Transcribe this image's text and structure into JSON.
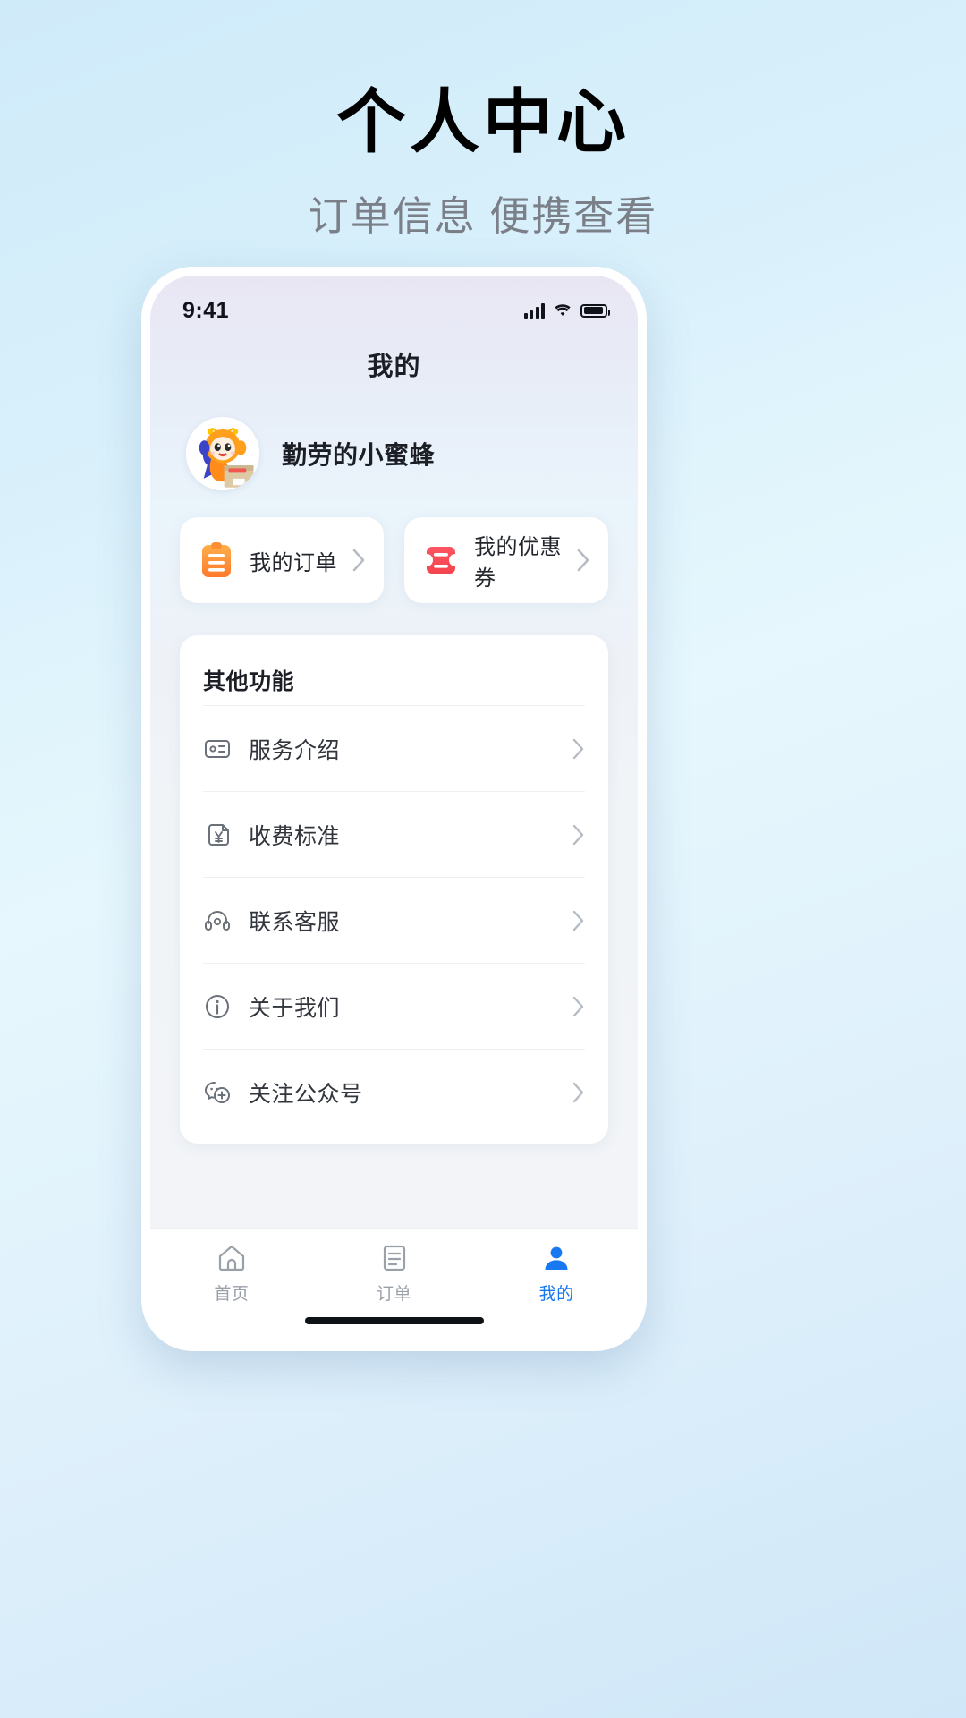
{
  "promo": {
    "title": "个人中心",
    "subtitle": "订单信息 便携查看"
  },
  "phone": {
    "statusbar": {
      "time": "9:41",
      "signal_icon": "cellular-signal-icon",
      "wifi_icon": "wifi-icon",
      "battery_icon": "battery-icon"
    },
    "navbar": {
      "title": "我的"
    },
    "profile": {
      "avatar_icon": "bee-mascot-avatar",
      "username": "勤劳的小蜜蜂"
    },
    "quick_cards": [
      {
        "label": "我的订单",
        "icon": "clipboard-order-icon",
        "color": "#ff8a3d",
        "chevron": "chevron-right-icon"
      },
      {
        "label": "我的优惠券",
        "icon": "coupon-ticket-icon",
        "color": "#f8515e",
        "chevron": "chevron-right-icon"
      }
    ],
    "others": {
      "header": "其他功能",
      "items": [
        {
          "label": "服务介绍",
          "icon": "id-card-icon",
          "chevron": "chevron-right-icon"
        },
        {
          "label": "收费标准",
          "icon": "price-tag-yuan-icon",
          "chevron": "chevron-right-icon"
        },
        {
          "label": "联系客服",
          "icon": "headset-support-icon",
          "chevron": "chevron-right-icon"
        },
        {
          "label": "关于我们",
          "icon": "info-circle-icon",
          "chevron": "chevron-right-icon"
        },
        {
          "label": "关注公众号",
          "icon": "wechat-official-icon",
          "chevron": "chevron-right-icon"
        }
      ]
    },
    "tabbar": {
      "active_color": "#1878f0",
      "inactive_color": "#9aa0a8",
      "tabs": [
        {
          "label": "首页",
          "icon": "home-icon",
          "active": false
        },
        {
          "label": "订单",
          "icon": "order-list-icon",
          "active": false
        },
        {
          "label": "我的",
          "icon": "person-icon",
          "active": true
        }
      ]
    }
  }
}
